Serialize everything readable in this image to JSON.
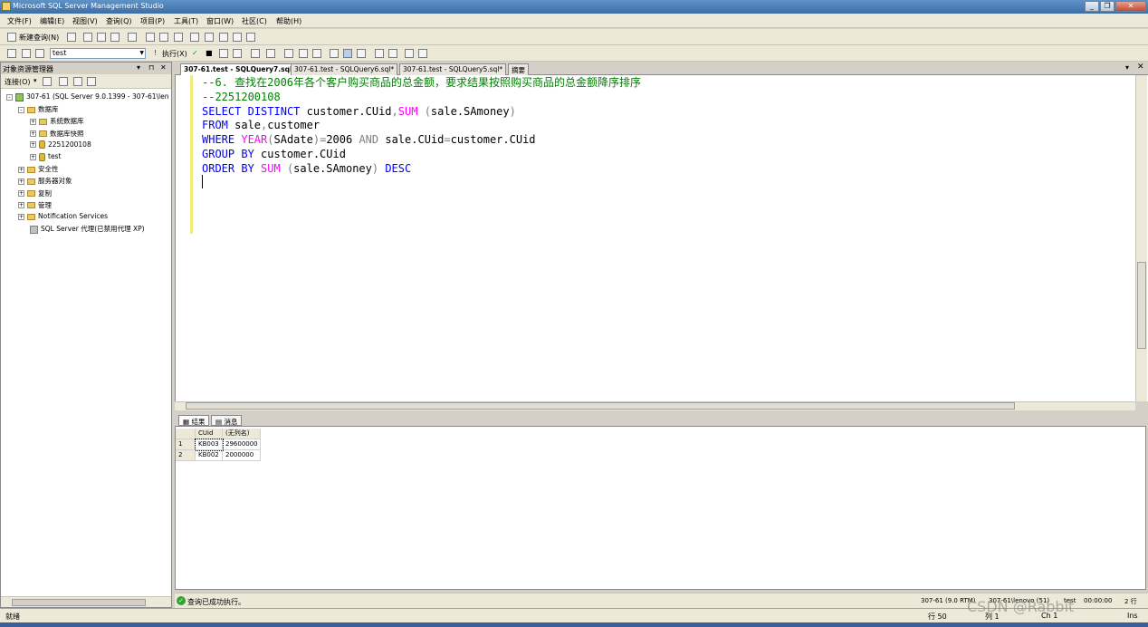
{
  "window": {
    "title": "Microsoft SQL Server Management Studio"
  },
  "menu": [
    "文件(F)",
    "编辑(E)",
    "视图(V)",
    "查询(Q)",
    "项目(P)",
    "工具(T)",
    "窗口(W)",
    "社区(C)",
    "帮助(H)"
  ],
  "toolbar1": {
    "new_query_label": "新建查询(N)"
  },
  "toolbar2": {
    "database_value": "test",
    "execute_label": "执行(X)"
  },
  "object_explorer": {
    "title": "对象资源管理器",
    "connect_label": "连接(O)",
    "tree": [
      {
        "label": "307-61 (SQL Server 9.0.1399 - 307-61\\len",
        "expander": "⊟",
        "icon": "server-icon",
        "indent": 0
      },
      {
        "label": "数据库",
        "expander": "⊟",
        "icon": "folder-icon",
        "indent": 1
      },
      {
        "label": "系统数据库",
        "expander": "⊞",
        "icon": "folder-icon",
        "indent": 2
      },
      {
        "label": "数据库快照",
        "expander": "⊞",
        "icon": "folder-icon",
        "indent": 2
      },
      {
        "label": "2251200108",
        "expander": "⊞",
        "icon": "database-icon",
        "indent": 2
      },
      {
        "label": "test",
        "expander": "⊞",
        "icon": "database-icon",
        "indent": 2
      },
      {
        "label": "安全性",
        "expander": "⊞",
        "icon": "folder-icon",
        "indent": 1
      },
      {
        "label": "服务器对象",
        "expander": "⊞",
        "icon": "folder-icon",
        "indent": 1
      },
      {
        "label": "复制",
        "expander": "⊞",
        "icon": "folder-icon",
        "indent": 1
      },
      {
        "label": "管理",
        "expander": "⊞",
        "icon": "folder-icon",
        "indent": 1
      },
      {
        "label": "Notification Services",
        "expander": "⊞",
        "icon": "folder-icon",
        "indent": 1
      },
      {
        "label": "SQL Server 代理(已禁用代理 XP)",
        "expander": "",
        "icon": "agent-icon",
        "indent": 1
      }
    ]
  },
  "tabs": [
    {
      "label": "307-61.test - SQLQuery7.sql*",
      "active": true
    },
    {
      "label": "307-61.test - SQLQuery6.sql*",
      "active": false
    },
    {
      "label": "307-61.test - SQLQuery5.sql*",
      "active": false
    },
    {
      "label": "摘要",
      "active": false
    }
  ],
  "editor": {
    "lines": [
      [
        {
          "t": "--6. 查找在2006年各个客户购买商品的总金额，要求结果按照购买商品的总金额降序排序",
          "c": "cm"
        }
      ],
      [
        {
          "t": "--2251200108",
          "c": "cm"
        }
      ],
      [
        {
          "t": "SELECT",
          "c": "kw"
        },
        {
          "t": " ",
          "c": "tx"
        },
        {
          "t": "DISTINCT",
          "c": "kw"
        },
        {
          "t": " customer.CUid",
          "c": "tx"
        },
        {
          "t": ",",
          "c": "gr"
        },
        {
          "t": "SUM",
          "c": "fn"
        },
        {
          "t": " (",
          "c": "gr"
        },
        {
          "t": "sale.SAmoney",
          "c": "tx"
        },
        {
          "t": ")",
          "c": "gr"
        }
      ],
      [
        {
          "t": "FROM",
          "c": "kw"
        },
        {
          "t": " sale",
          "c": "tx"
        },
        {
          "t": ",",
          "c": "gr"
        },
        {
          "t": "customer",
          "c": "tx"
        }
      ],
      [
        {
          "t": "WHERE",
          "c": "kw"
        },
        {
          "t": " ",
          "c": "tx"
        },
        {
          "t": "YEAR",
          "c": "fn"
        },
        {
          "t": "(",
          "c": "gr"
        },
        {
          "t": "SAdate",
          "c": "tx"
        },
        {
          "t": ")=",
          "c": "gr"
        },
        {
          "t": "2006",
          "c": "tx"
        },
        {
          "t": " AND",
          "c": "gr"
        },
        {
          "t": " sale.CUid",
          "c": "tx"
        },
        {
          "t": "=",
          "c": "gr"
        },
        {
          "t": "customer.CUid",
          "c": "tx"
        }
      ],
      [
        {
          "t": "GROUP BY",
          "c": "kw"
        },
        {
          "t": " customer.CUid",
          "c": "tx"
        }
      ],
      [
        {
          "t": "ORDER BY",
          "c": "kw"
        },
        {
          "t": " ",
          "c": "tx"
        },
        {
          "t": "SUM",
          "c": "fn"
        },
        {
          "t": " (",
          "c": "gr"
        },
        {
          "t": "sale.SAmoney",
          "c": "tx"
        },
        {
          "t": ")",
          "c": "gr"
        },
        {
          "t": " DESC",
          "c": "kw"
        }
      ]
    ]
  },
  "results": {
    "tab_results": "结果",
    "tab_messages": "消息",
    "columns": [
      "CUid",
      "(无列名)"
    ],
    "rows": [
      {
        "num": "1",
        "cells": [
          "KB003",
          "29600000"
        ]
      },
      {
        "num": "2",
        "cells": [
          "KB002",
          "2000000"
        ]
      }
    ]
  },
  "query_status": {
    "message": "查询已成功执行。",
    "server": "307-61 (9.0 RTM)",
    "user": "307-61\\lenovo (51)",
    "database": "test",
    "elapsed": "00:00:00",
    "rows": "2 行"
  },
  "statusbar": {
    "ready": "就绪",
    "line": "行 50",
    "col": "列 1",
    "ch": "Ch 1",
    "mode": "Ins"
  },
  "watermark": "CSDN @Rabbit"
}
